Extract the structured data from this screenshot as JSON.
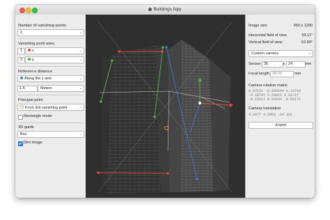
{
  "window": {
    "title": "Buildings.fspy"
  },
  "left": {
    "num_vp_label": "Number of vanishing points",
    "num_vp_value": "2",
    "vp_axes_label": "Vanishing point axes",
    "axis1_index": "1",
    "axis1_value": "x",
    "axis1_color": "#e04a3c",
    "axis2_index": "2",
    "axis2_value": "y",
    "axis2_color": "#4caf3c",
    "ref_distance_label": "Reference distance",
    "ref_distance_value": "Along the z axis",
    "ref_distance_color": "#3a7bd5",
    "ref_amount": "1.5",
    "ref_unit": "Meters",
    "principal_point_label": "Principal point",
    "principal_point_value": "From 3rd vanishing point",
    "principal_point_color": "#e8a33c",
    "rectangle_mode_label": "Rectangle mode",
    "guide_label": "3D guide",
    "guide_value": "Box",
    "dim_image_label": "Dim image",
    "chevron": "⌄"
  },
  "right": {
    "image_size_label": "Image size",
    "image_size_value": "960 x 1200",
    "hfov_label": "Horizontal field of view",
    "hfov_value": "53.11°",
    "vfov_label": "Vertical field of view",
    "vfov_value": "63.99°",
    "camera_preset": "Custom camera",
    "sensor_label": "Sensor",
    "sensor_w": "36",
    "sensor_x": "x",
    "sensor_h": "24",
    "sensor_unit": "mm",
    "focal_label": "Focal length",
    "focal_value": "38.02",
    "focal_unit": "mm",
    "rot_label": "Camera rotation matrix",
    "rot_rows": [
      "0.97521  -0.099544  0.19743",
      "-0.18747  0.54611   0.81727",
      "-0.19312  0.83194  -0.54171"
    ],
    "trans_label": "Camera translation",
    "trans_row": "4.1077    4.6953    -29.321",
    "export_label": "Export"
  },
  "colors": {
    "x_axis": "#e04a3c",
    "y_axis": "#4caf3c",
    "z_axis": "#3a7bd5",
    "viewport_bg": "#2f2f2f"
  }
}
